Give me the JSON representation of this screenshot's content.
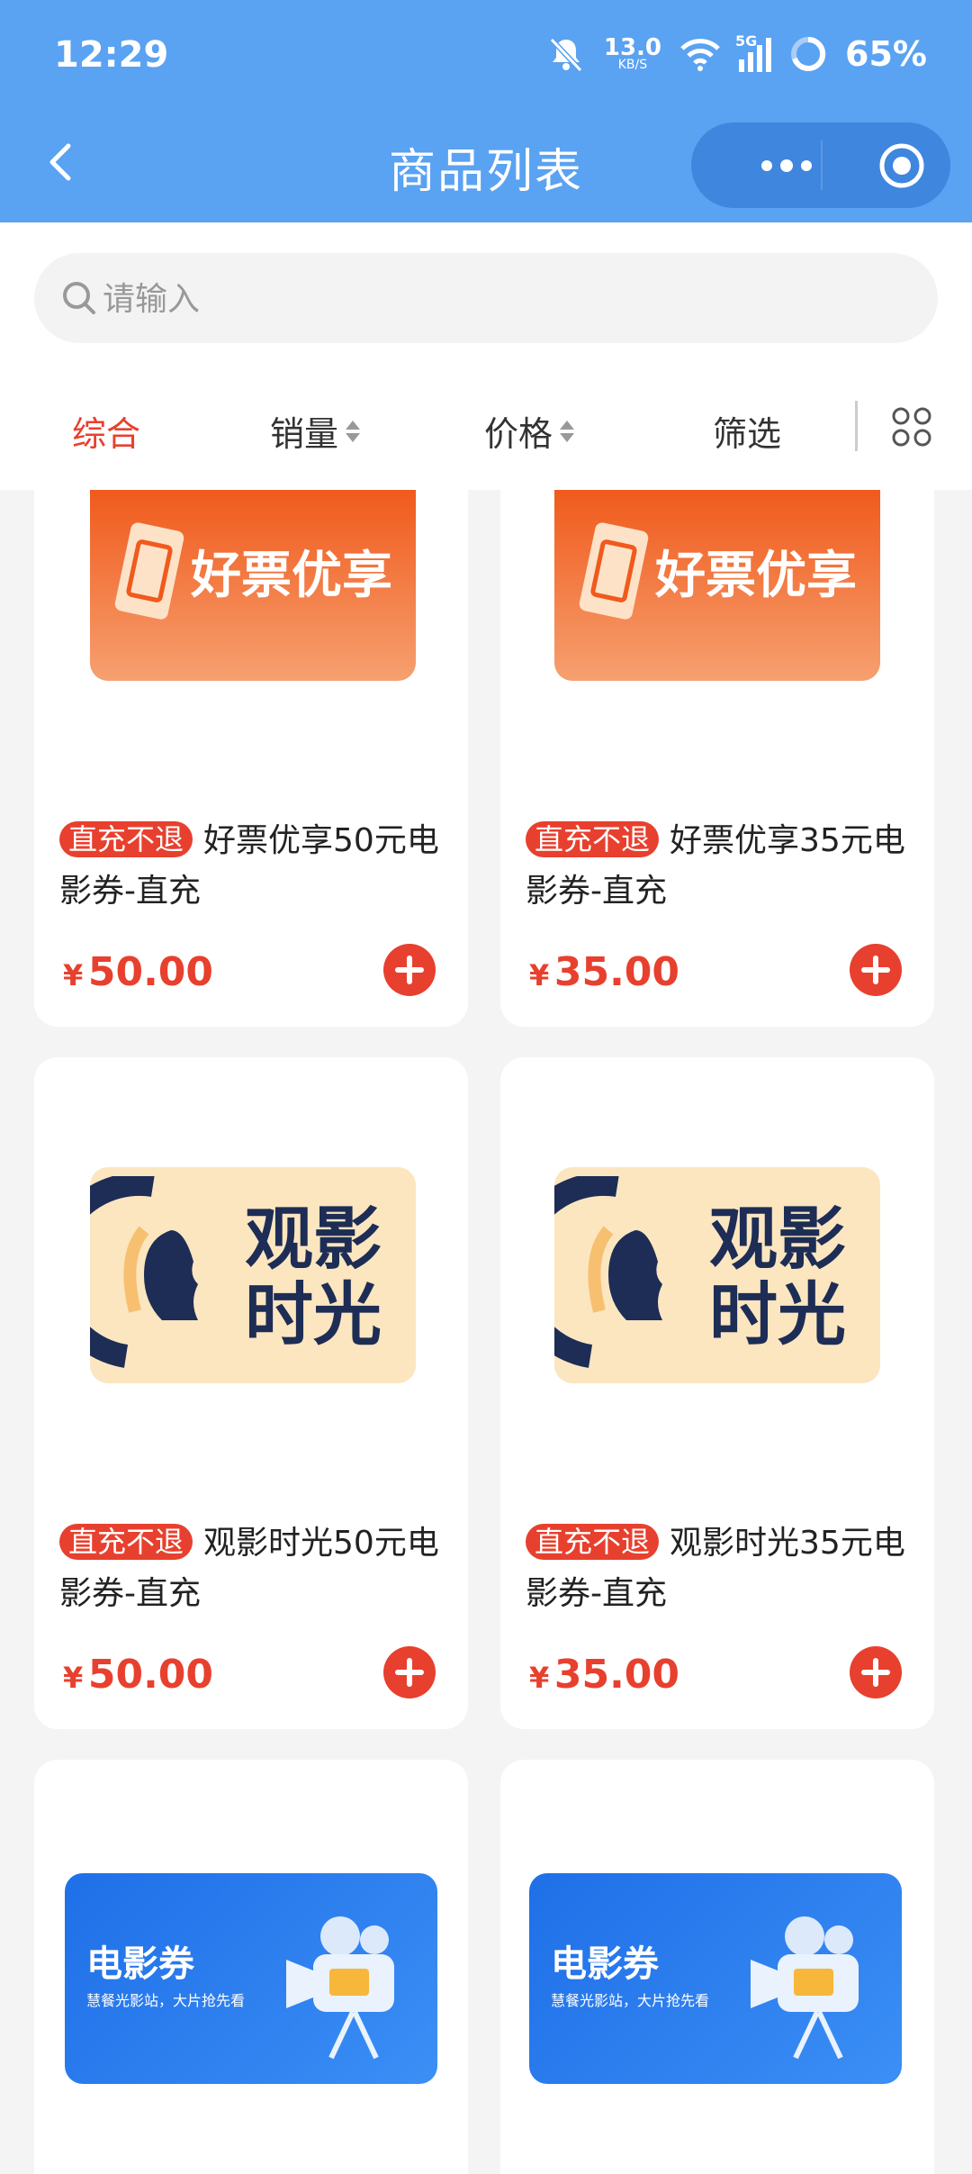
{
  "status_bar": {
    "time": "12:29",
    "net_speed_value": "13.0",
    "net_speed_unit": "KB/S",
    "signal": "5G",
    "battery": "65%"
  },
  "nav": {
    "title": "商品列表"
  },
  "search": {
    "placeholder": "请输入"
  },
  "sort": {
    "comprehensive": "综合",
    "sales": "销量",
    "price": "价格",
    "filter": "筛选"
  },
  "products": [
    {
      "tag": "直充不退",
      "name": "好票优享50元电影券-直充",
      "currency": "¥",
      "price": "50.00",
      "image": "haopiao-youxiang",
      "image_text": "好票优享"
    },
    {
      "tag": "直充不退",
      "name": "好票优享35元电影券-直充",
      "currency": "¥",
      "price": "35.00",
      "image": "haopiao-youxiang",
      "image_text": "好票优享"
    },
    {
      "tag": "直充不退",
      "name": "观影时光50元电影券-直充",
      "currency": "¥",
      "price": "50.00",
      "image": "guanying-shiguang",
      "image_text_1": "观影",
      "image_text_2": "时光"
    },
    {
      "tag": "直充不退",
      "name": "观影时光35元电影券-直充",
      "currency": "¥",
      "price": "35.00",
      "image": "guanying-shiguang",
      "image_text_1": "观影",
      "image_text_2": "时光"
    },
    {
      "image": "dianyingquan",
      "image_title": "电影券",
      "image_sub": "慧餐光影站，大片抢先看"
    },
    {
      "image": "dianyingquan",
      "image_title": "电影券",
      "image_sub": "慧餐光影站，大片抢先看"
    }
  ],
  "colors": {
    "header_blue": "#5aa2f2",
    "accent_red": "#e8402e"
  }
}
